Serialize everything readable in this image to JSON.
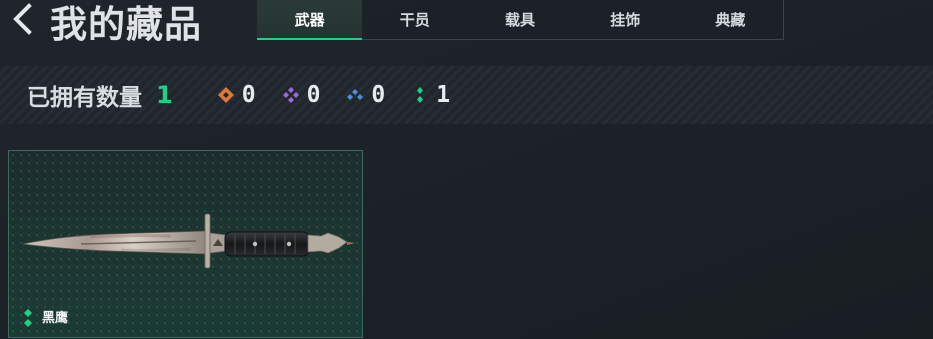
{
  "header": {
    "title": "我的藏品",
    "back_icon": "chevron-left-icon"
  },
  "tabs": [
    {
      "label": "武器",
      "active": true
    },
    {
      "label": "干员",
      "active": false
    },
    {
      "label": "载具",
      "active": false
    },
    {
      "label": "挂饰",
      "active": false
    },
    {
      "label": "典藏",
      "active": false
    }
  ],
  "stats": {
    "label": "已拥有数量",
    "total": "1",
    "tiers": [
      {
        "icon": "orange-diamond-icon",
        "color": "#d9783a",
        "count": "0"
      },
      {
        "icon": "purple-diamond-cluster-icon",
        "color": "#9c6ade",
        "count": "0"
      },
      {
        "icon": "blue-diamond-cluster-icon",
        "color": "#4d8fd6",
        "count": "0"
      },
      {
        "icon": "green-diamond-pair-icon",
        "color": "#1ed184",
        "count": "1"
      }
    ]
  },
  "items": [
    {
      "name": "黑鹰",
      "rarity_icon": "green-diamond-pair-icon",
      "rarity_color": "#1ed184",
      "image": "knife-icon"
    }
  ],
  "colors": {
    "accent": "#1ed184",
    "background": "#1c2228"
  }
}
